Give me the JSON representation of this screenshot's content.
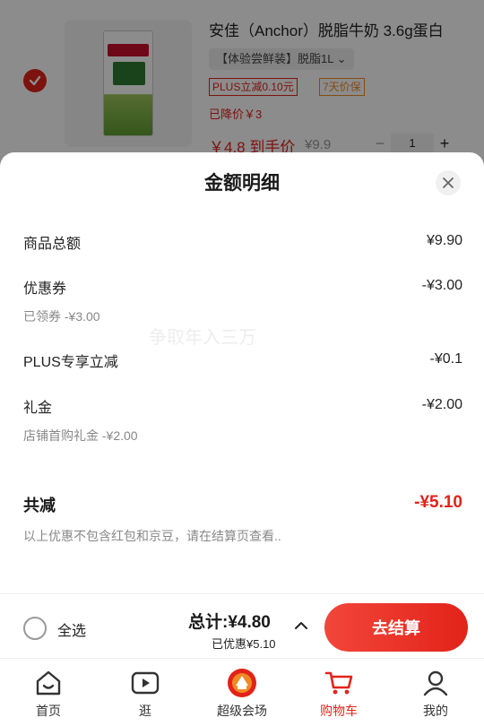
{
  "cart_item": {
    "title": "安佳（Anchor）脱脂牛奶 3.6g蛋白",
    "spec": "【体验尝鲜装】脱脂1L",
    "tags": [
      "PLUS立减0.10元",
      "7天价保"
    ],
    "price_drop": "已降价￥3",
    "price": "￥4.8 到手价",
    "original_price": "¥9.9",
    "quantity": "1",
    "minus": "−",
    "plus": "+"
  },
  "sheet": {
    "title": "金额明细",
    "rows": [
      {
        "label": "商品总额",
        "value": "¥9.90"
      },
      {
        "label": "优惠券",
        "value": "-¥3.00",
        "sub": "已领券 -¥3.00"
      },
      {
        "label": "PLUS专享立减",
        "value": "-¥0.1"
      },
      {
        "label": "礼金",
        "value": "-¥2.00",
        "sub": "店铺首购礼金 -¥2.00"
      }
    ],
    "total_label": "共减",
    "total_value": "-¥5.10",
    "note": "以上优惠不包含红包和京豆，请在结算页查看..",
    "watermark": "争取年入三万"
  },
  "checkout": {
    "select_all": "全选",
    "sum": "总计:¥4.80",
    "saved": "已优惠¥5.10",
    "pay_button": "去结算"
  },
  "tabs": [
    {
      "label": "首页",
      "icon": "home-icon"
    },
    {
      "label": "逛",
      "icon": "video-icon"
    },
    {
      "label": "超级会场",
      "icon": "venue-icon"
    },
    {
      "label": "购物车",
      "icon": "cart-icon",
      "active": true
    },
    {
      "label": "我的",
      "icon": "profile-icon"
    }
  ],
  "colors": {
    "accent": "#e2231a",
    "orange_tag": "#f08a24",
    "muted_text": "#888888"
  }
}
